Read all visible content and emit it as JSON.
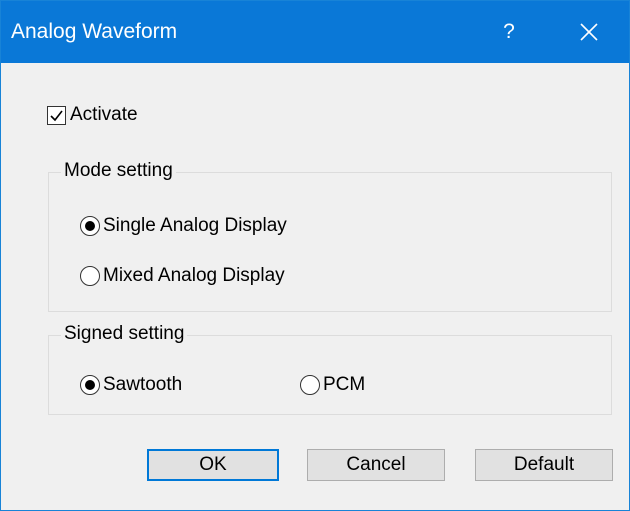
{
  "window": {
    "title": "Analog Waveform",
    "help_label": "?",
    "accent_color": "#0a78d7"
  },
  "activate": {
    "label": "Activate",
    "checked": true
  },
  "mode_setting": {
    "title": "Mode setting",
    "options": [
      {
        "label": "Single Analog Display",
        "checked": true
      },
      {
        "label": "Mixed Analog Display",
        "checked": false
      }
    ]
  },
  "signed_setting": {
    "title": "Signed setting",
    "options": [
      {
        "label": "Sawtooth",
        "checked": true
      },
      {
        "label": "PCM",
        "checked": false
      }
    ]
  },
  "buttons": {
    "ok": "OK",
    "cancel": "Cancel",
    "default": "Default"
  },
  "icons": {
    "help": "help-icon",
    "close": "close-icon",
    "check": "checkmark-icon"
  }
}
